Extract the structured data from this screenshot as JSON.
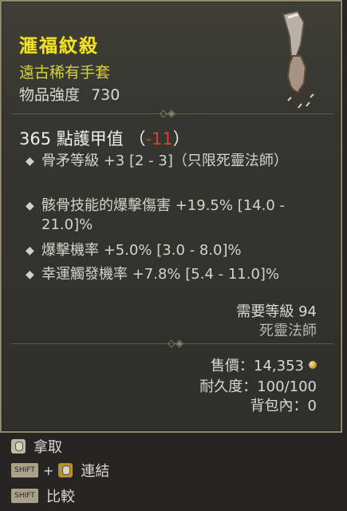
{
  "item": {
    "name": "滙福紋殺",
    "subtitle": "遠古稀有手套",
    "power_label": "物品強度",
    "power_value": "730"
  },
  "armor": {
    "value": "365",
    "label": "點護甲值",
    "open": "（",
    "delta": "-11",
    "close": "）"
  },
  "affixes": [
    {
      "text": "骨矛等級 +3 [2 - 3]（只限死靈法師）"
    },
    {
      "text": "骸骨技能的爆擊傷害 +19.5% [14.0 - 21.0]%"
    },
    {
      "text": "爆擊機率 +5.0% [3.0 - 8.0]%"
    },
    {
      "text": "幸運觸發機率 +7.8% [5.4 - 11.0]%"
    }
  ],
  "requirements": {
    "level": "需要等級 94",
    "class": "死靈法師"
  },
  "stats": {
    "price": "售價：14,353",
    "durability": "耐久度：100/100",
    "inventory": "背包內：0"
  },
  "actions": [
    {
      "label": "拿取",
      "icon": "mouse-left-icon"
    },
    {
      "label": "連結",
      "icon": "shift-plus-mouse-icon",
      "key": "SHIFT",
      "plus": "+"
    },
    {
      "label": "比較",
      "icon": "shift-key-icon",
      "key": "SHIFT"
    }
  ],
  "colors": {
    "name": "#f1e22b",
    "subtitle": "#d8cf47",
    "negative": "#e23b32",
    "border": "#8f8a6a"
  }
}
